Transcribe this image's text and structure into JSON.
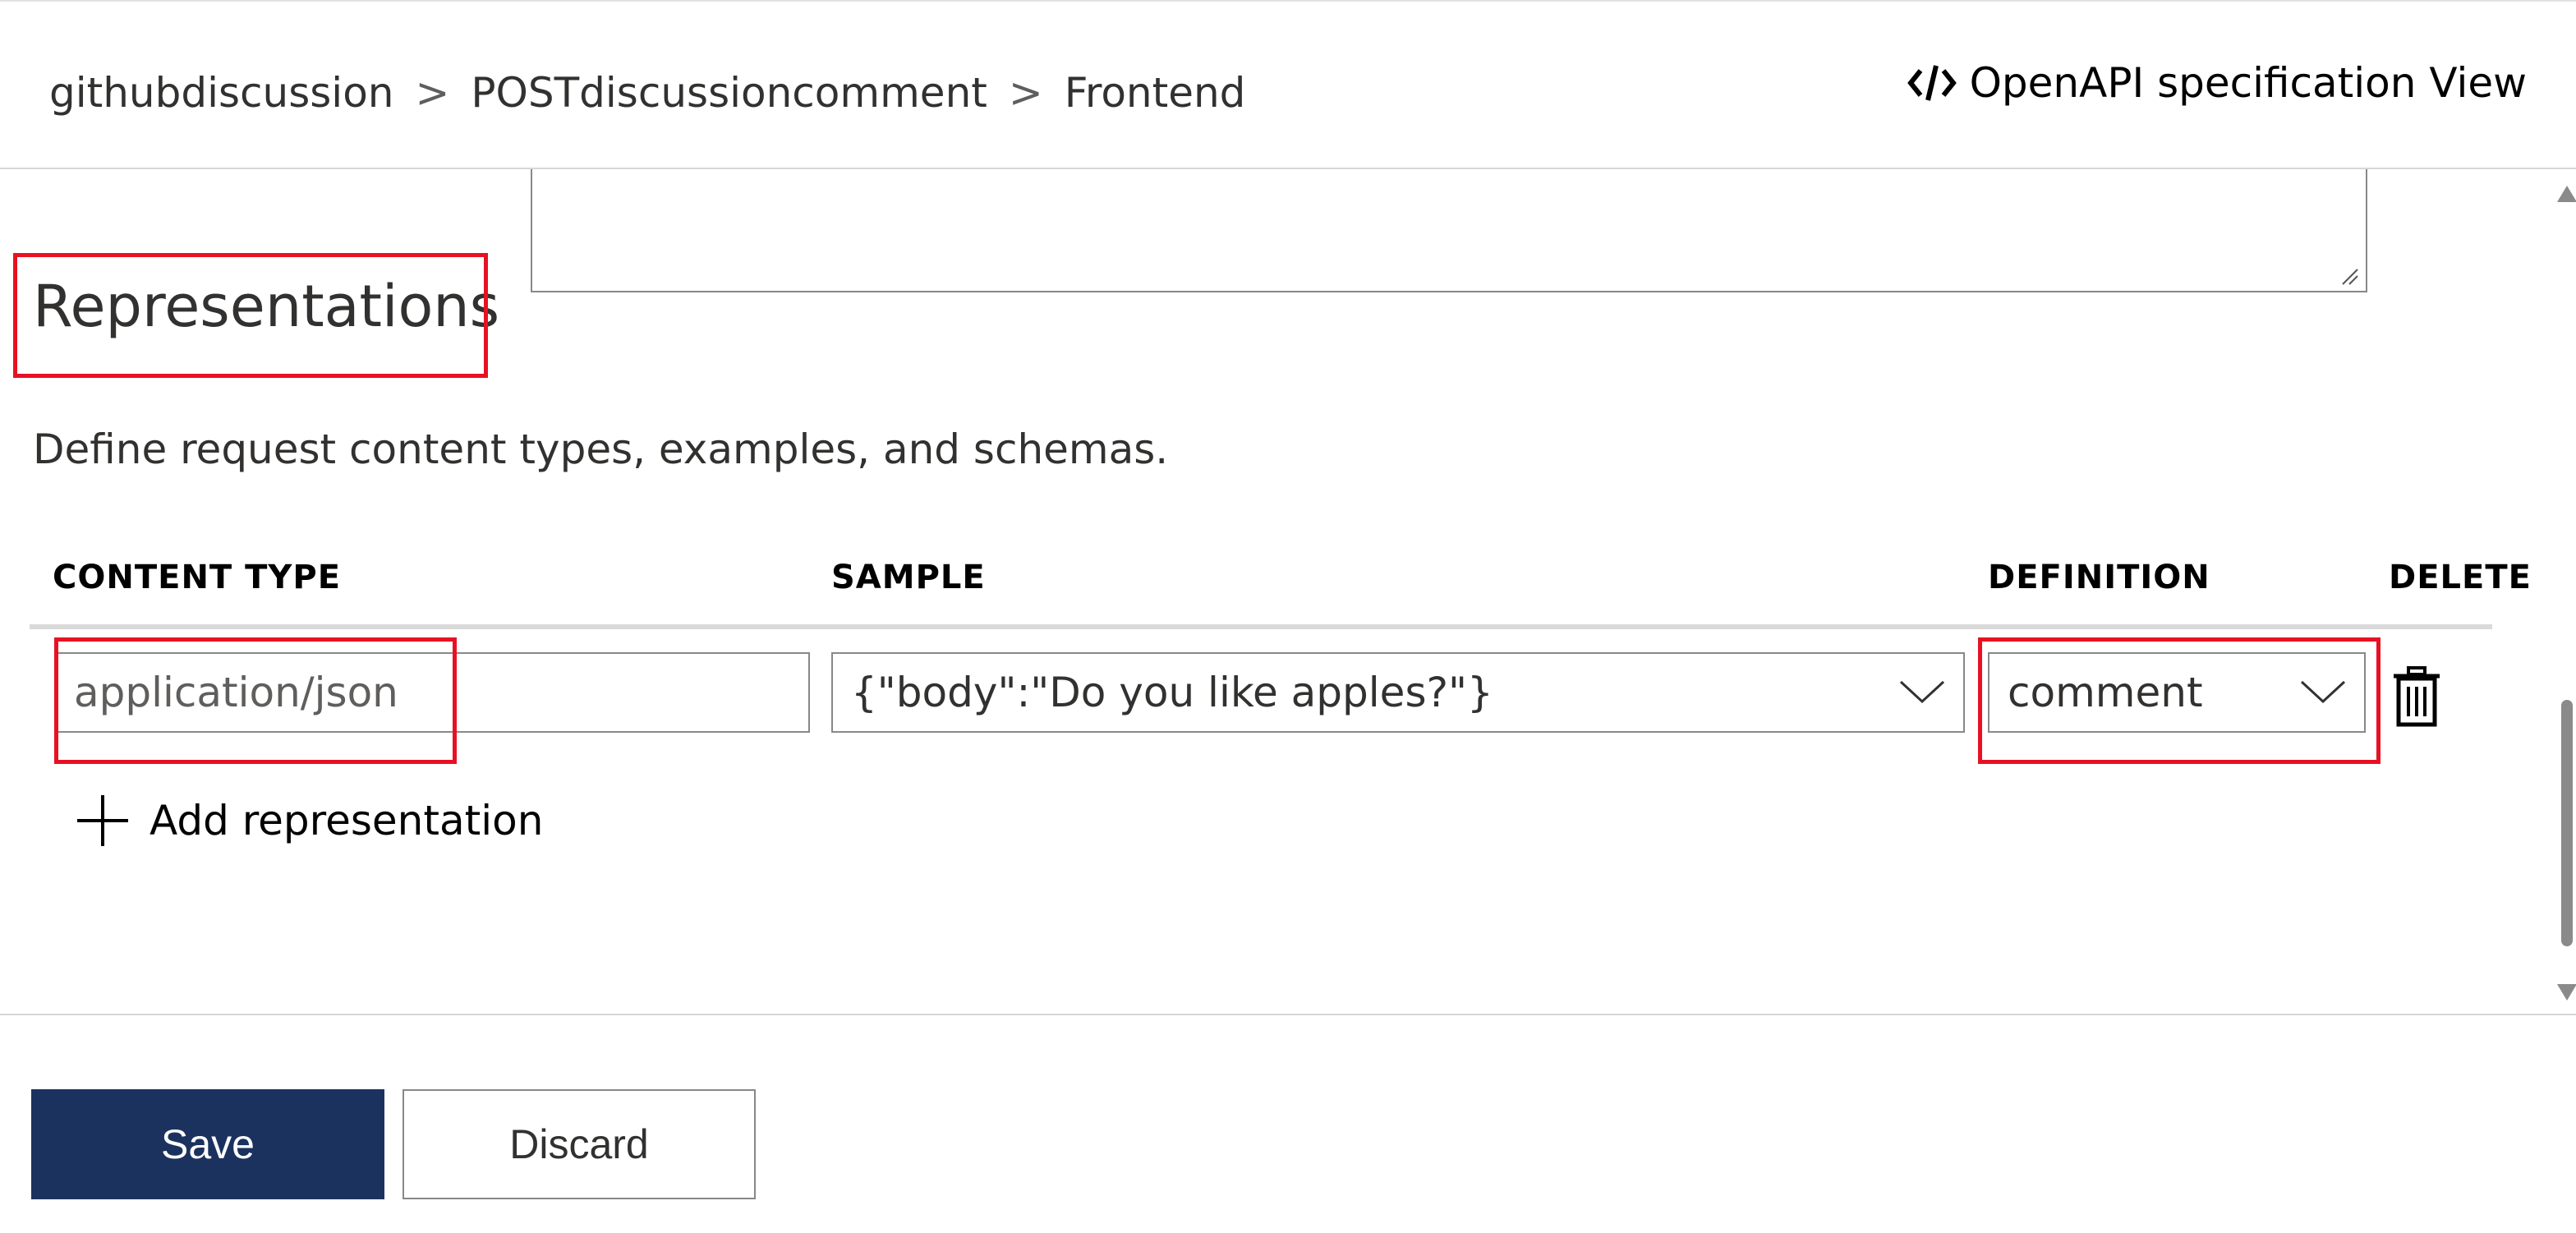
{
  "breadcrumb": {
    "items": [
      "githubdiscussion",
      "POSTdiscussioncomment",
      "Frontend"
    ],
    "separator": ">"
  },
  "header": {
    "openapi_label": "OpenAPI specification View",
    "openapi_icon": "code-icon"
  },
  "representations": {
    "title": "Representations",
    "description": "Define request content types, examples, and schemas.",
    "columns": {
      "content_type": "CONTENT TYPE",
      "sample": "SAMPLE",
      "definition": "DEFINITION",
      "delete": "DELETE"
    },
    "rows": [
      {
        "content_type": "application/json",
        "sample": "{\"body\":\"Do you like apples?\"}",
        "definition": "comment"
      }
    ],
    "add_label": "Add representation"
  },
  "footer": {
    "save_label": "Save",
    "discard_label": "Discard"
  },
  "colors": {
    "primary": "#1b325f",
    "highlight": "#e81123",
    "border": "#8a8886"
  }
}
